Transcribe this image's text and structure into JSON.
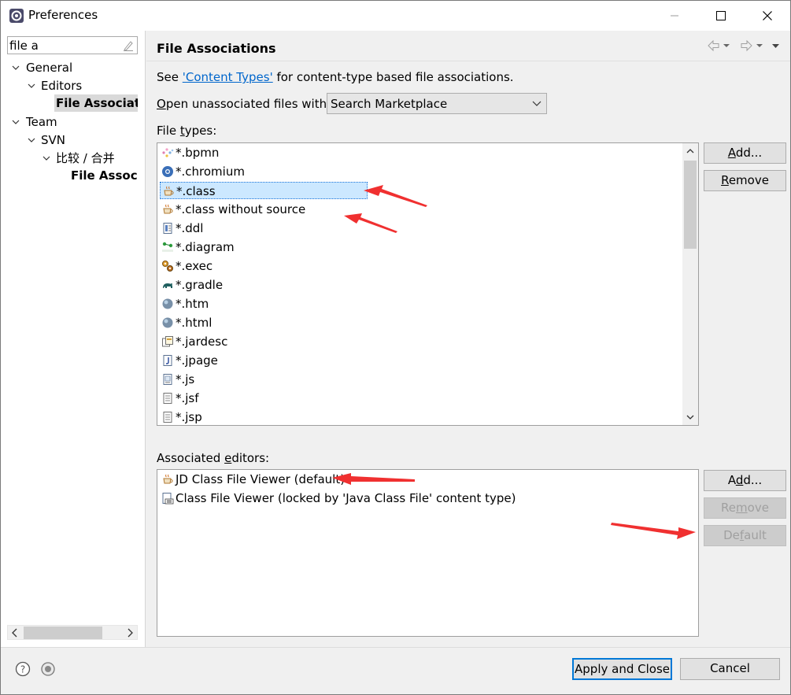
{
  "window": {
    "title": "Preferences"
  },
  "left": {
    "filter_value": "file a",
    "tree": [
      {
        "label": "General"
      },
      {
        "label": "Editors"
      },
      {
        "label": "File Associatio"
      },
      {
        "label": "Team"
      },
      {
        "label": "SVN"
      },
      {
        "label": "比较 / 合并"
      },
      {
        "label": "File Associa"
      }
    ]
  },
  "right": {
    "title": "File Associations",
    "see_prefix": "See ",
    "see_link": "'Content Types'",
    "see_suffix": " for content-type based file associations.",
    "open_label_pre": "O",
    "open_label_rest": "pen unassociated files with:",
    "open_value": "Search Marketplace",
    "filetypes_label_pre": "File ",
    "filetypes_label_u": "t",
    "filetypes_label_rest": "ypes:",
    "file_types": [
      {
        "label": "*.bpmn",
        "icon": "bpmn-icon"
      },
      {
        "label": "*.chromium",
        "icon": "globe-icon"
      },
      {
        "label": "*.class",
        "icon": "coffee-cup-icon"
      },
      {
        "label": "*.class without source",
        "icon": "coffee-cup-icon"
      },
      {
        "label": "*.ddl",
        "icon": "sql-file-icon"
      },
      {
        "label": "*.diagram",
        "icon": "diagram-icon"
      },
      {
        "label": "*.exec",
        "icon": "gears-icon"
      },
      {
        "label": "*.gradle",
        "icon": "elephant-icon"
      },
      {
        "label": "*.htm",
        "icon": "web-globe-icon"
      },
      {
        "label": "*.html",
        "icon": "web-globe-icon"
      },
      {
        "label": "*.jardesc",
        "icon": "jar-file-icon"
      },
      {
        "label": "*.jpage",
        "icon": "java-file-icon"
      },
      {
        "label": "*.js",
        "icon": "js-file-icon"
      },
      {
        "label": "*.jsf",
        "icon": "text-file-icon"
      },
      {
        "label": "*.jsp",
        "icon": "text-file-icon"
      }
    ],
    "add_type_pre": "A",
    "add_type_rest": "dd...",
    "remove_type_pre": "R",
    "remove_type_rest": "emove",
    "assoc_label_pre": "Associated ",
    "assoc_label_u": "e",
    "assoc_label_rest": "ditors:",
    "editors": [
      {
        "label": "JD Class File Viewer (default)",
        "icon": "coffee-cup-icon"
      },
      {
        "label": "Class File Viewer (locked by 'Java Class File' content type)",
        "icon": "class-binary-icon"
      }
    ],
    "add_editor_pre": "A",
    "add_editor_u": "d",
    "add_editor_rest": "d...",
    "remove_editor_pre": "Re",
    "remove_editor_u": "m",
    "remove_editor_rest": "ove",
    "default_editor_pre": "De",
    "default_editor_u": "f",
    "default_editor_rest": "ault"
  },
  "bottom": {
    "apply_close": "Apply and Close",
    "cancel": "Cancel"
  },
  "colors": {
    "accent": "#0078d7",
    "selection": "#cce8ff",
    "annotation_arrow": "#f03030",
    "link": "#0066cc"
  }
}
